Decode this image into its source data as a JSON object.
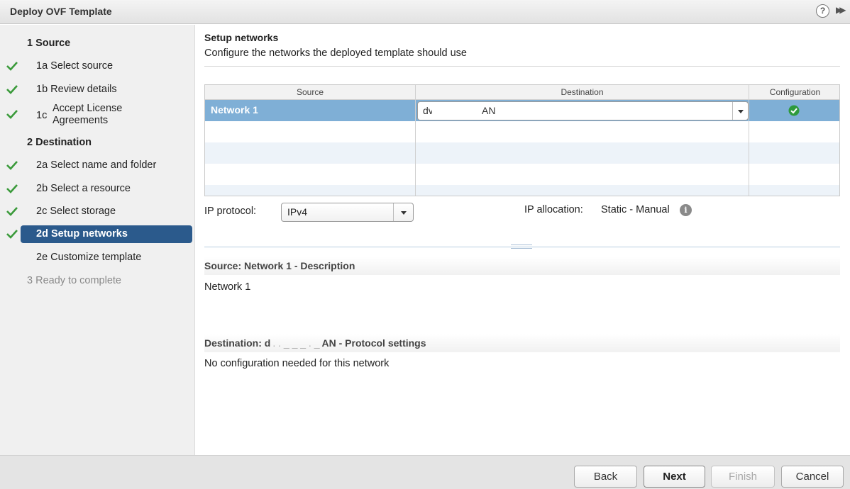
{
  "window": {
    "title": "Deploy OVF Template",
    "help_icon": "?",
    "expand_icon": "▶▶"
  },
  "sidebar": {
    "steps": [
      {
        "label": "1  Source",
        "type": "section",
        "checked": false
      },
      {
        "label": "1a  Select source",
        "type": "sub",
        "checked": true
      },
      {
        "label": "1b  Review details",
        "type": "sub",
        "checked": true
      },
      {
        "num": "1c",
        "label": "Accept License\nAgreements",
        "type": "sub",
        "checked": true
      },
      {
        "label": "2  Destination",
        "type": "section",
        "checked": false
      },
      {
        "label": "2a  Select name and folder",
        "type": "sub",
        "checked": true
      },
      {
        "label": "2b  Select a resource",
        "type": "sub",
        "checked": true
      },
      {
        "label": "2c  Select storage",
        "type": "sub",
        "checked": true
      },
      {
        "label": "2d  Setup networks",
        "type": "sub",
        "checked": true,
        "active": true
      },
      {
        "label": "2e  Customize template",
        "type": "sub",
        "checked": false
      },
      {
        "label": "3  Ready to complete",
        "type": "section",
        "checked": false,
        "disabled": true
      }
    ]
  },
  "main": {
    "heading": "Setup networks",
    "subheading": "Configure the networks the deployed template should use",
    "grid": {
      "columns": [
        "Source",
        "Destination",
        "Configuration"
      ],
      "rows": [
        {
          "source": "Network 1",
          "destination_prefix": "dv",
          "destination_suffix": "AN",
          "config_status": "ok"
        }
      ]
    },
    "ip_protocol": {
      "label": "IP protocol:",
      "value": "IPv4"
    },
    "ip_allocation": {
      "label": "IP allocation:",
      "value": "Static - Manual"
    },
    "source_desc": {
      "title": "Source: Network 1 - Description",
      "body": "Network 1"
    },
    "dest_settings": {
      "title_prefix": "Destination: d",
      "title_mid": ". . _ _ _ . _",
      "title_suffix": "AN - Protocol settings",
      "body": "No configuration needed for this network"
    }
  },
  "footer": {
    "back": "Back",
    "next": "Next",
    "finish": "Finish",
    "cancel": "Cancel"
  },
  "colors": {
    "accent": "#2b5a8c",
    "selected_row": "#7fafd6",
    "check": "#3a9a3a"
  }
}
